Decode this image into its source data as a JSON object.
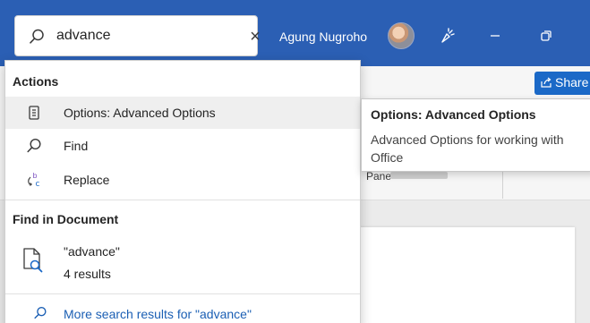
{
  "titlebar": {
    "search_value": "advance",
    "user_name": "Agung Nugroho",
    "clear_icon": "×"
  },
  "ribbon": {
    "share_label": "Share",
    "pane_label": "Pane"
  },
  "dropdown": {
    "actions_header": "Actions",
    "actions": [
      {
        "label": "Options: Advanced Options",
        "icon": "options-icon"
      },
      {
        "label": "Find",
        "icon": "search-icon"
      },
      {
        "label": "Replace",
        "icon": "replace-icon"
      }
    ],
    "find_header": "Find in Document",
    "doc_result": {
      "query": "\"advance\"",
      "count": "4 results"
    },
    "more_results": "More search results for \"advance\""
  },
  "tooltip": {
    "title": "Options: Advanced Options",
    "description": "Advanced Options for working with Office"
  },
  "colors": {
    "titlebar": "#2b5fb4",
    "accent": "#1b69c7",
    "link": "#1b5fb4"
  }
}
